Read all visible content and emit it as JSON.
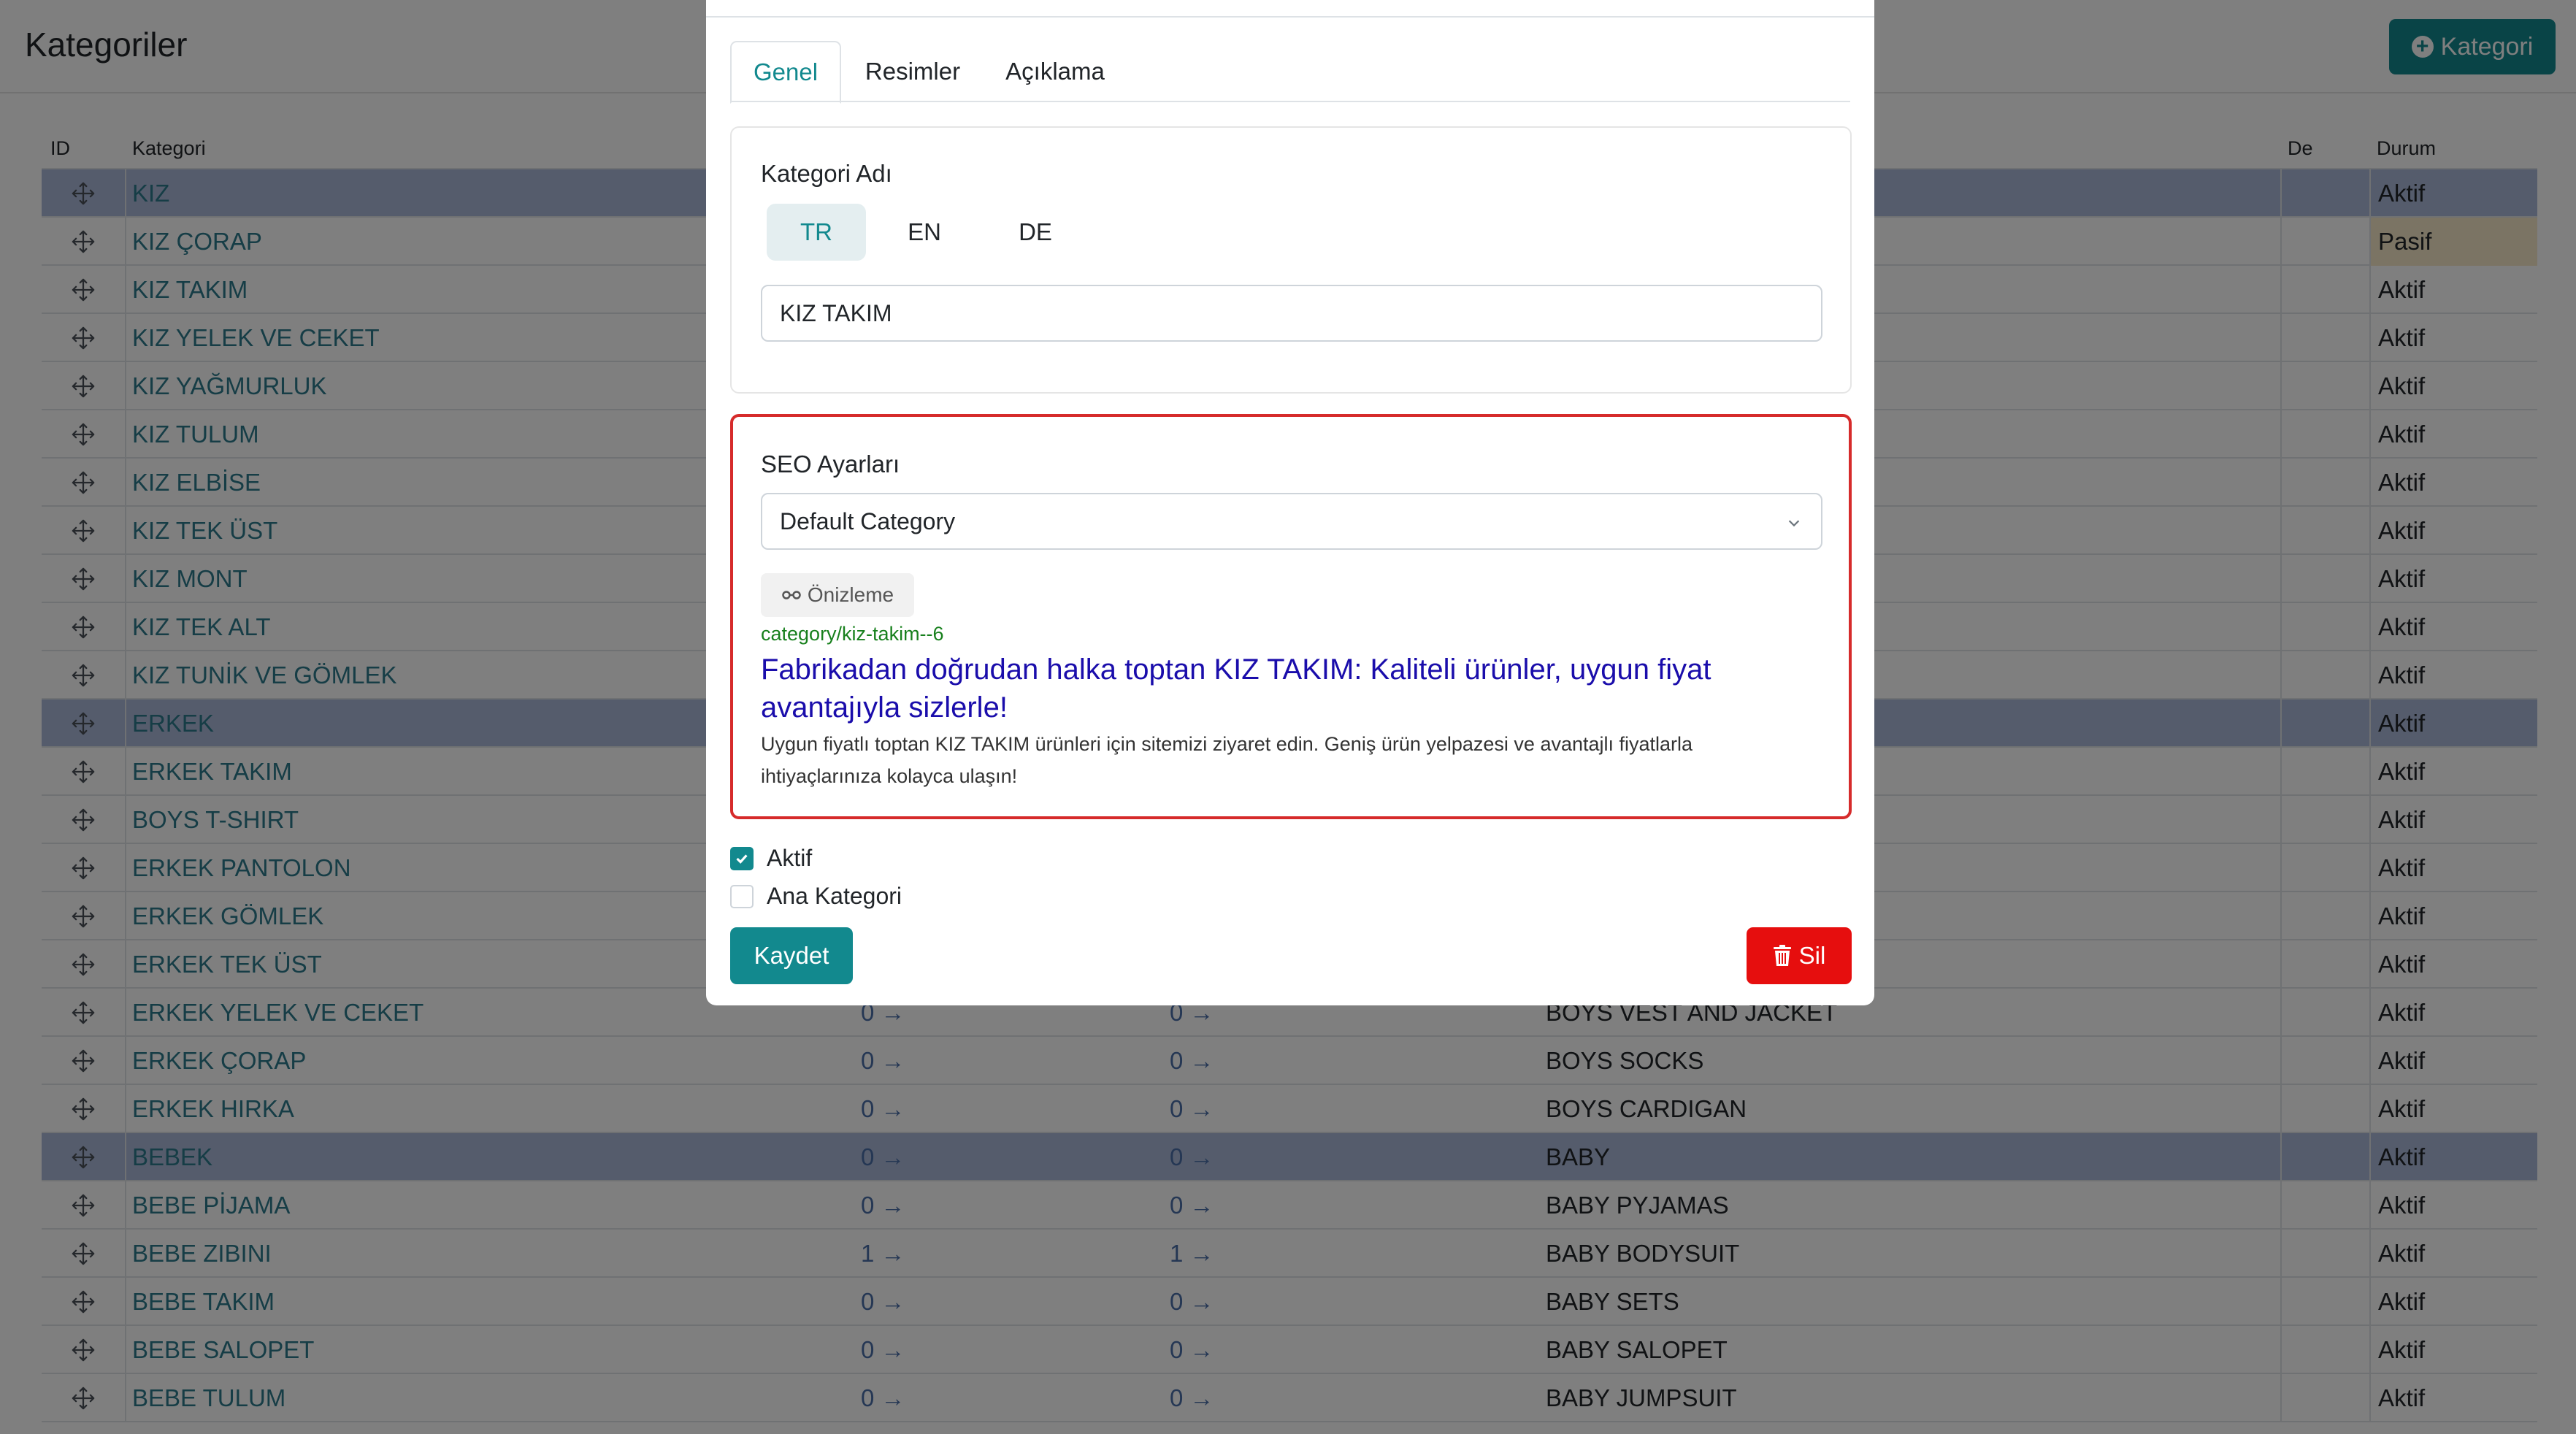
{
  "page": {
    "title": "Kategoriler",
    "add_button_label": "Kategori"
  },
  "table": {
    "headers": {
      "id": "ID",
      "name": "Kategori",
      "de": "De",
      "status": "Durum"
    },
    "rows": [
      {
        "name": "KIZ",
        "n1": "",
        "n2": "",
        "en": "",
        "status": "Aktif",
        "highlight": true
      },
      {
        "name": "KIZ ÇORAP",
        "n1": "",
        "n2": "",
        "en": "",
        "status": "Pasif",
        "highlight": false
      },
      {
        "name": "KIZ TAKIM",
        "n1": "",
        "n2": "",
        "en": "",
        "status": "Aktif",
        "highlight": false
      },
      {
        "name": "KIZ YELEK VE CEKET",
        "n1": "",
        "n2": "",
        "en": "",
        "status": "Aktif",
        "highlight": false
      },
      {
        "name": "KIZ YAĞMURLUK",
        "n1": "",
        "n2": "",
        "en": "",
        "status": "Aktif",
        "highlight": false
      },
      {
        "name": "KIZ TULUM",
        "n1": "",
        "n2": "",
        "en": "",
        "status": "Aktif",
        "highlight": false
      },
      {
        "name": "KIZ ELBİSE",
        "n1": "",
        "n2": "",
        "en": "",
        "status": "Aktif",
        "highlight": false
      },
      {
        "name": "KIZ TEK ÜST",
        "n1": "",
        "n2": "",
        "en": "",
        "status": "Aktif",
        "highlight": false
      },
      {
        "name": "KIZ MONT",
        "n1": "",
        "n2": "",
        "en": "",
        "status": "Aktif",
        "highlight": false
      },
      {
        "name": "KIZ TEK ALT",
        "n1": "",
        "n2": "",
        "en": "",
        "status": "Aktif",
        "highlight": false
      },
      {
        "name": "KIZ TUNİK VE GÖMLEK",
        "n1": "",
        "n2": "",
        "en": "",
        "status": "Aktif",
        "highlight": false
      },
      {
        "name": "ERKEK",
        "n1": "",
        "n2": "",
        "en": "",
        "status": "Aktif",
        "highlight": true
      },
      {
        "name": "ERKEK TAKIM",
        "n1": "",
        "n2": "",
        "en": "",
        "status": "Aktif",
        "highlight": false
      },
      {
        "name": "BOYS T-SHIRT",
        "n1": "",
        "n2": "",
        "en": "",
        "status": "Aktif",
        "highlight": false
      },
      {
        "name": "ERKEK PANTOLON",
        "n1": "",
        "n2": "",
        "en": "",
        "status": "Aktif",
        "highlight": false
      },
      {
        "name": "ERKEK GÖMLEK",
        "n1": "",
        "n2": "",
        "en": "",
        "status": "Aktif",
        "highlight": false
      },
      {
        "name": "ERKEK TEK ÜST",
        "n1": "",
        "n2": "",
        "en": "",
        "status": "Aktif",
        "highlight": false
      },
      {
        "name": "ERKEK YELEK VE CEKET",
        "n1": "0 →",
        "n2": "0 →",
        "en": "BOYS VEST AND JACKET",
        "status": "Aktif",
        "highlight": false
      },
      {
        "name": "ERKEK ÇORAP",
        "n1": "0 →",
        "n2": "0 →",
        "en": "BOYS SOCKS",
        "status": "Aktif",
        "highlight": false
      },
      {
        "name": "ERKEK HIRKA",
        "n1": "0 →",
        "n2": "0 →",
        "en": "BOYS CARDIGAN",
        "status": "Aktif",
        "highlight": false
      },
      {
        "name": "BEBEK",
        "n1": "0 →",
        "n2": "0 →",
        "en": "BABY",
        "status": "Aktif",
        "highlight": true
      },
      {
        "name": "BEBE PİJAMA",
        "n1": "0 →",
        "n2": "0 →",
        "en": "BABY PYJAMAS",
        "status": "Aktif",
        "highlight": false
      },
      {
        "name": "BEBE ZIBINI",
        "n1": "1 →",
        "n2": "1 →",
        "en": "BABY BODYSUIT",
        "status": "Aktif",
        "highlight": false
      },
      {
        "name": "BEBE TAKIM",
        "n1": "0 →",
        "n2": "0 →",
        "en": "BABY SETS",
        "status": "Aktif",
        "highlight": false
      },
      {
        "name": "BEBE SALOPET",
        "n1": "0 →",
        "n2": "0 →",
        "en": "BABY SALOPET",
        "status": "Aktif",
        "highlight": false
      },
      {
        "name": "BEBE TULUM",
        "n1": "0 →",
        "n2": "0 →",
        "en": "BABY JUMPSUIT",
        "status": "Aktif",
        "highlight": false
      }
    ]
  },
  "modal": {
    "tabs": [
      {
        "label": "Genel",
        "active": true
      },
      {
        "label": "Resimler",
        "active": false
      },
      {
        "label": "Açıklama",
        "active": false
      }
    ],
    "name_card": {
      "label": "Kategori Adı",
      "languages": [
        {
          "code": "TR",
          "active": true
        },
        {
          "code": "EN",
          "active": false
        },
        {
          "code": "DE",
          "active": false
        }
      ],
      "value": "KIZ TAKIM"
    },
    "seo_card": {
      "label": "SEO Ayarları",
      "select_value": "Default Category",
      "preview_label": "Önizleme",
      "url": "category/kiz-takim--6",
      "title": "Fabrikadan doğrudan halka toptan KIZ TAKIM: Kaliteli ürünler, uygun fiyat avantajıyla sizlerle!",
      "description": "Uygun fiyatlı toptan KIZ TAKIM ürünleri için sitemizi ziyaret edin. Geniş ürün yelpazesi ve avantajlı fiyatlarla ihtiyaçlarınıza kolayca ulaşın!"
    },
    "checkboxes": [
      {
        "label": "Aktif",
        "checked": true
      },
      {
        "label": "Ana Kategori",
        "checked": false
      }
    ],
    "save_label": "Kaydet",
    "delete_label": "Sil"
  },
  "colors": {
    "accent": "#12898e",
    "danger": "#e60e0e",
    "seo_border": "#d62b2b",
    "row_highlight": "#aab9d9",
    "pasif_bg": "#f7e9c8",
    "link": "#2c7a8c"
  },
  "icons": {
    "add": "plus-circle-icon",
    "move": "move-arrows-icon",
    "select_chevron": "chevron-down-icon",
    "preview": "glasses-icon",
    "check": "check-icon",
    "delete": "trash-icon"
  }
}
